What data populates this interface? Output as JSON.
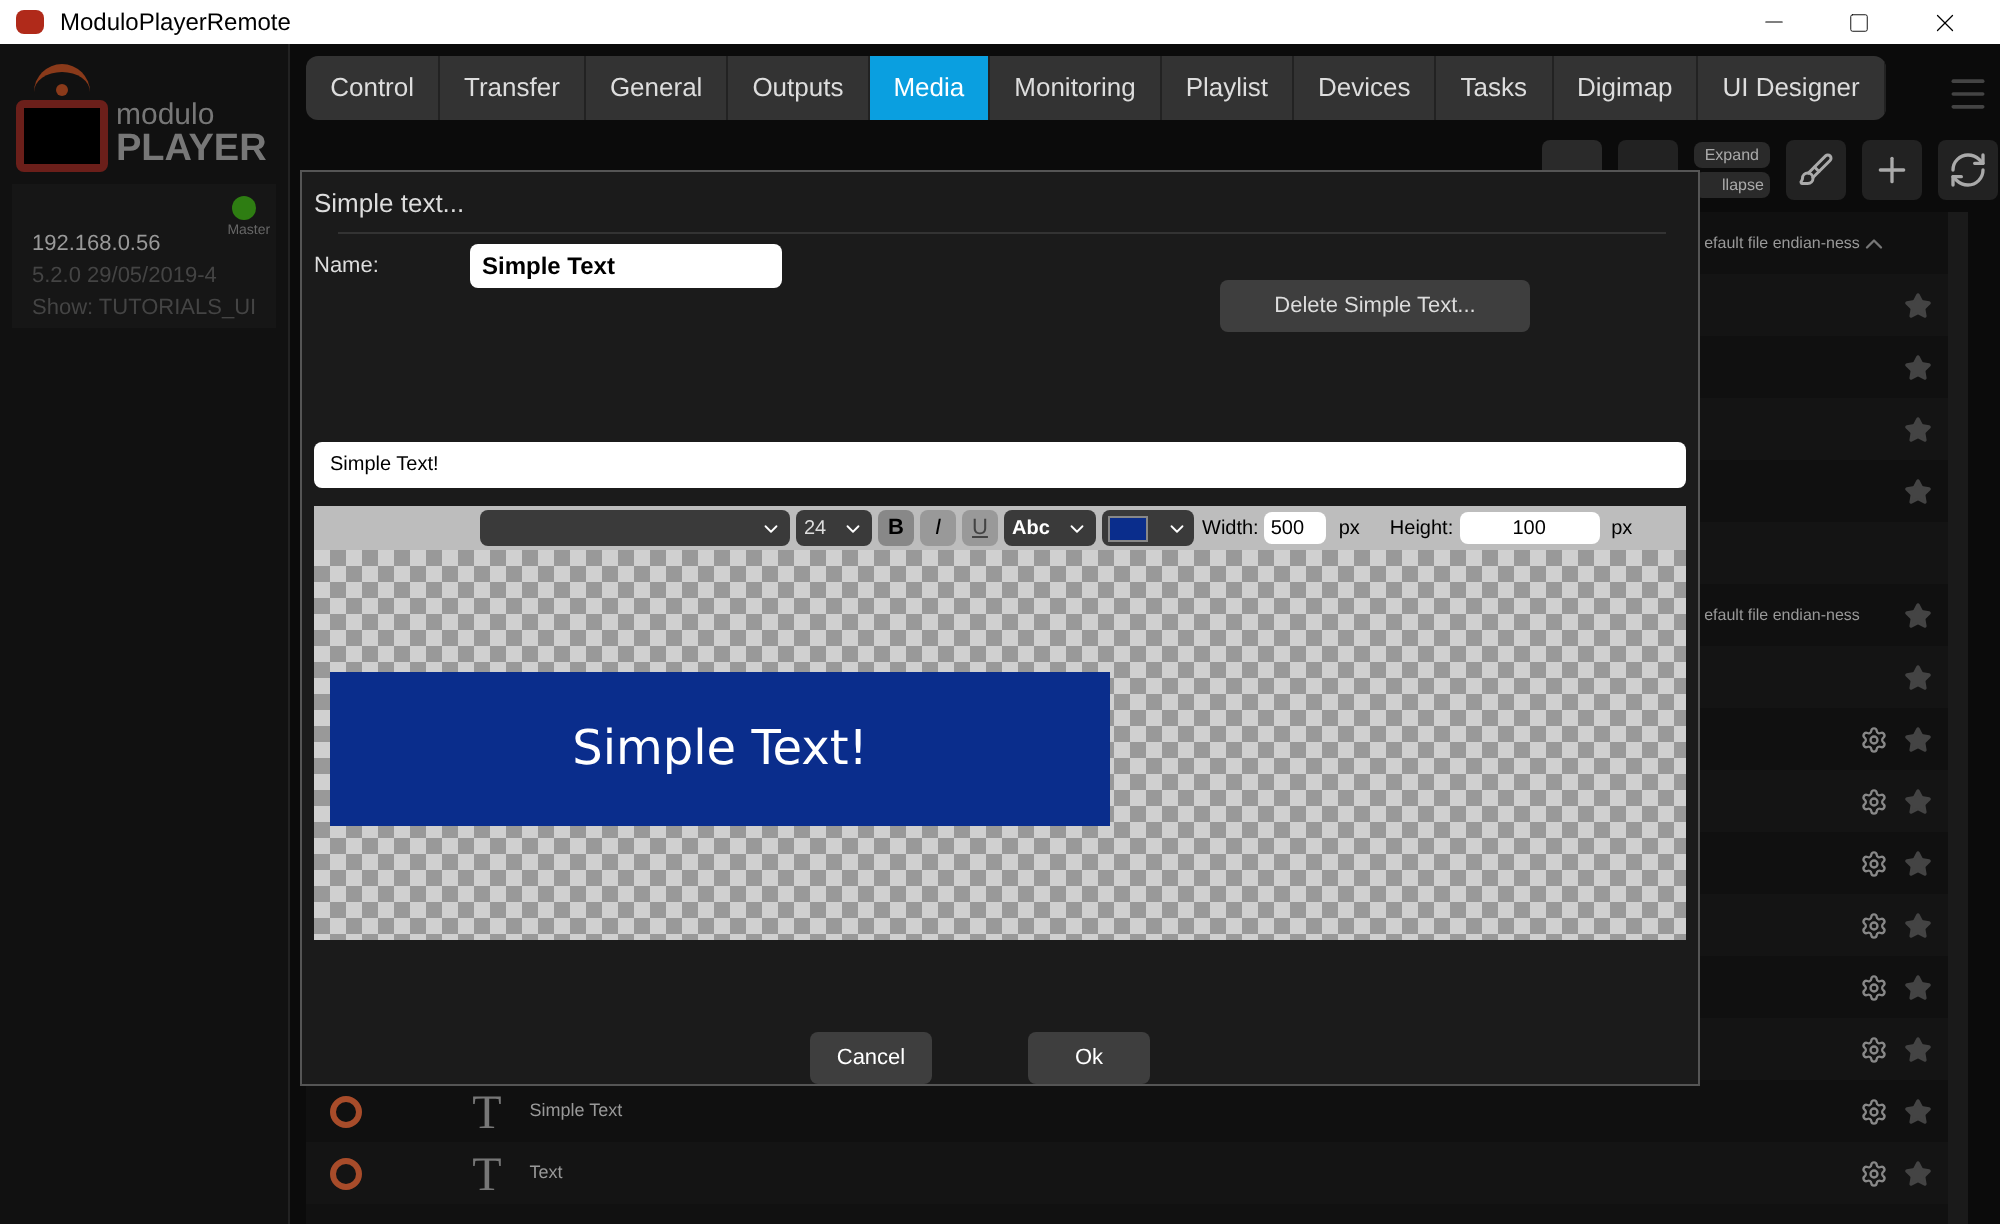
{
  "window": {
    "title": "ModuloPlayerRemote"
  },
  "logo": {
    "line1": "modulo",
    "line2": "PLAYER"
  },
  "device": {
    "online": true,
    "role": "Master",
    "ip": "192.168.0.56",
    "version": "5.2.0 29/05/2019-4",
    "show": "Show: TUTORIALS_UI"
  },
  "tabs": [
    {
      "label": "Control",
      "selected": false
    },
    {
      "label": "Transfer",
      "selected": false
    },
    {
      "label": "General",
      "selected": false
    },
    {
      "label": "Outputs",
      "selected": false
    },
    {
      "label": "Media",
      "selected": true
    },
    {
      "label": "Monitoring",
      "selected": false
    },
    {
      "label": "Playlist",
      "selected": false
    },
    {
      "label": "Devices",
      "selected": false
    },
    {
      "label": "Tasks",
      "selected": false
    },
    {
      "label": "Digimap",
      "selected": false
    },
    {
      "label": "UI Designer",
      "selected": false
    }
  ],
  "toolbar": {
    "expand": "Expand",
    "collapse": "llapse"
  },
  "media_rows": [
    {
      "text": "efault file endian-ness",
      "gear": false,
      "star": false,
      "caret": true
    },
    {
      "gear": false,
      "star": true
    },
    {
      "gear": false,
      "star": true
    },
    {
      "gear": false,
      "star": true
    },
    {
      "gear": false,
      "star": true
    },
    {
      "gear": false,
      "star": false
    },
    {
      "text": "efault file endian-ness",
      "gear": false,
      "star": true
    },
    {
      "gear": false,
      "star": true
    },
    {
      "gear": true,
      "star": true
    },
    {
      "gear": true,
      "star": true
    },
    {
      "gear": true,
      "star": true
    },
    {
      "gear": true,
      "star": true
    },
    {
      "gear": true,
      "star": true
    },
    {
      "gear": true,
      "star": true
    },
    {
      "text": "Simple Text",
      "icon": "T",
      "gear": true,
      "star": true
    },
    {
      "text": "Text",
      "icon": "T",
      "gear": true,
      "star": true
    }
  ],
  "dialog": {
    "title": "Simple text...",
    "name_label": "Name:",
    "name_value": "Simple Text",
    "delete_button": "Delete Simple Text...",
    "text_value": "Simple Text!",
    "editor": {
      "size": "24",
      "bold": "B",
      "italic": "I",
      "underline": "U",
      "style": "Abc",
      "color": "#0a2d8c",
      "width_label": "Width:",
      "width_value": "500",
      "width_unit": "px",
      "height_label": "Height:",
      "height_value": "100",
      "height_unit": "px"
    },
    "preview_text": "Simple Text!",
    "buttons": [
      "Cancel",
      "Ok"
    ]
  }
}
